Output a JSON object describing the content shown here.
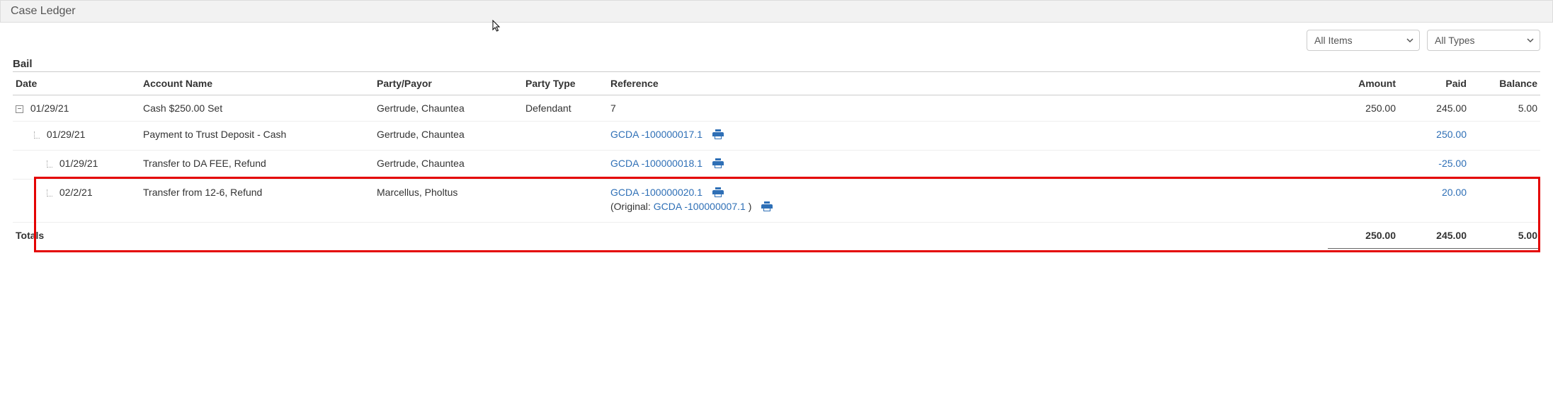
{
  "header": {
    "title": "Case Ledger"
  },
  "filters": {
    "items_label": "All Items",
    "types_label": "All Types"
  },
  "section": {
    "title": "Bail"
  },
  "columns": {
    "date": "Date",
    "account": "Account Name",
    "party": "Party/Payor",
    "party_type": "Party Type",
    "reference": "Reference",
    "amount": "Amount",
    "paid": "Paid",
    "balance": "Balance"
  },
  "rows": {
    "r0": {
      "date": "01/29/21",
      "account": "Cash $250.00 Set",
      "party": "Gertrude, Chauntea",
      "party_type": "Defendant",
      "reference": "7",
      "amount": "250.00",
      "paid": "245.00",
      "balance": "5.00"
    },
    "r1": {
      "date": "01/29/21",
      "account": "Payment to Trust Deposit - Cash",
      "party": "Gertrude, Chauntea",
      "reference": "GCDA -100000017.1",
      "paid": "250.00"
    },
    "r2": {
      "date": "01/29/21",
      "account": "Transfer to DA FEE, Refund",
      "party": "Gertrude, Chauntea",
      "reference": "GCDA -100000018.1",
      "paid": "-25.00"
    },
    "r3": {
      "date": "02/2/21",
      "account": "Transfer from 12-6, Refund",
      "party": "Marcellus, Pholtus",
      "reference": "GCDA -100000020.1",
      "original_prefix": "(Original: ",
      "original_ref": "GCDA -100000007.1",
      "original_suffix": " )",
      "paid": "20.00"
    }
  },
  "totals": {
    "label": "Totals",
    "amount": "250.00",
    "paid": "245.00",
    "balance": "5.00"
  }
}
